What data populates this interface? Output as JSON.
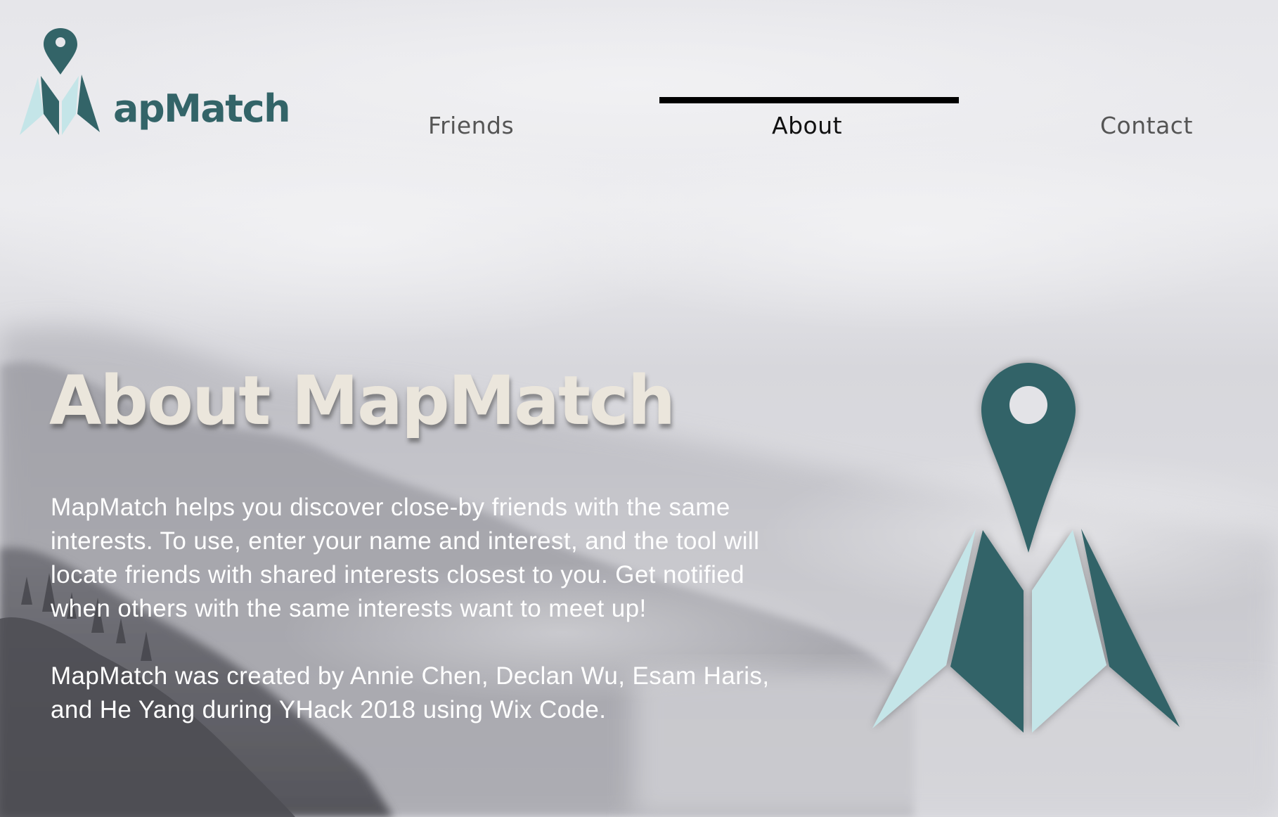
{
  "brand": {
    "name": "apMatch",
    "logo_icon": "map-pin-m-logo",
    "colors": {
      "teal": "#336468",
      "light_teal": "#c4e5e8"
    }
  },
  "nav": {
    "items": [
      {
        "label": "Friends",
        "active": false
      },
      {
        "label": "About",
        "active": true
      },
      {
        "label": "Contact",
        "active": false
      }
    ]
  },
  "hero": {
    "title": "About MapMatch",
    "paragraphs": [
      "MapMatch helps you discover close-by friends with the same interests. To use, enter your name and interest, and the tool will locate friends with shared interests closest to you. Get notified when others with the same interests want to meet up!",
      "MapMatch was created by Annie Chen, Declan Wu, Esam Haris, and He Yang during YHack 2018 using Wix Code."
    ]
  }
}
